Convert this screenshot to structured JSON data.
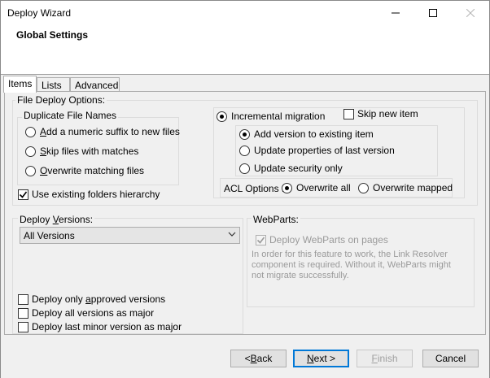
{
  "window": {
    "title": "Deploy Wizard"
  },
  "header": {
    "title": "Global Settings"
  },
  "tabs": [
    {
      "label": "Items",
      "active": true
    },
    {
      "label": "Lists",
      "active": false
    },
    {
      "label": "Advanced",
      "active": false
    }
  ],
  "file_deploy": {
    "label": "File Deploy Options:",
    "duplicate": {
      "label": "Duplicate File Names",
      "options": [
        {
          "pre": "",
          "ul": "A",
          "post": "dd a numeric suffix to new files",
          "selected": false
        },
        {
          "pre": "",
          "ul": "S",
          "post": "kip files with matches",
          "selected": false
        },
        {
          "pre": "",
          "ul": "O",
          "post": "verwrite matching files",
          "selected": false
        }
      ]
    },
    "use_existing_folders": {
      "label": "Use existing folders hierarchy",
      "checked": true
    },
    "incremental": {
      "label": "Incremental migration",
      "selected": true
    },
    "skip_new_item": {
      "label": "Skip new item",
      "checked": false
    },
    "version_options": [
      {
        "label": "Add version to existing item",
        "selected": true
      },
      {
        "label": "Update properties of last version",
        "selected": false
      },
      {
        "label": "Update security only",
        "selected": false
      }
    ],
    "acl": {
      "label": "ACL Options :",
      "options": [
        {
          "label": "Overwrite all",
          "selected": true
        },
        {
          "label": "Overwrite mapped",
          "selected": false
        }
      ]
    }
  },
  "deploy_versions": {
    "label_pre": "Deploy ",
    "label_ul": "V",
    "label_post": "ersions:",
    "selected": "All Versions",
    "options": [
      {
        "pre": "Deploy only ",
        "ul": "a",
        "post": "pproved versions",
        "checked": false
      },
      {
        "pre": "Deploy all versions as major",
        "ul": "",
        "post": "",
        "checked": false
      },
      {
        "pre": "Deploy last minor version as major",
        "ul": "",
        "post": "",
        "checked": false
      }
    ]
  },
  "webparts": {
    "label": "WebParts:",
    "deploy": {
      "label": "Deploy WebParts on pages",
      "checked": true,
      "enabled": false
    },
    "note": "In order for this feature to work, the Link Resolver component is required. Without it, WebParts might not migrate successfully."
  },
  "buttons": {
    "back": {
      "pre": "< ",
      "ul": "B",
      "post": "ack"
    },
    "next": {
      "pre": "",
      "ul": "N",
      "post": "ext >"
    },
    "finish": {
      "pre": "",
      "ul": "F",
      "post": "inish"
    },
    "cancel": "Cancel"
  }
}
